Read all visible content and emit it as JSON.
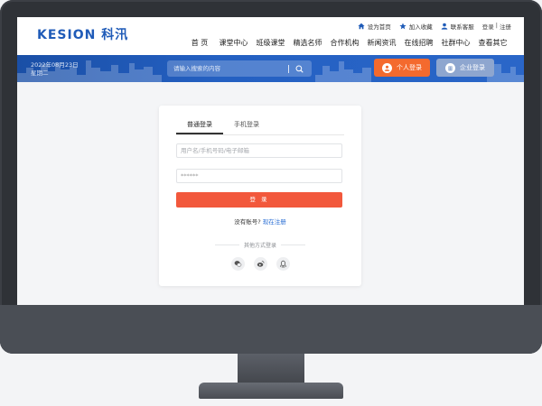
{
  "header": {
    "logo": "KESION 科汛",
    "top_links": [
      {
        "icon": "home-icon",
        "label": "设为首页"
      },
      {
        "icon": "star-icon",
        "label": "加入收藏"
      },
      {
        "icon": "user-icon",
        "label": "联系客服"
      }
    ],
    "login_label": "登录",
    "auth_separator": "|",
    "register_label": "注册",
    "nav": [
      "首 页",
      "课堂中心",
      "班级课堂",
      "精选名师",
      "合作机构",
      "新闻资讯",
      "在线招聘",
      "社群中心",
      "查看其它"
    ]
  },
  "banner": {
    "date": "2022年08月23日",
    "weekday": "星期二",
    "search_placeholder": "请输入搜索的内容",
    "personal_login": "个人登录",
    "company_login": "企业登录"
  },
  "login": {
    "tabs": [
      "普通登录",
      "手机登录"
    ],
    "active_tab": 0,
    "username_placeholder": "用户名/手机号码/电子邮箱",
    "password_value": "******",
    "login_button": "登 录",
    "no_account": "没有账号?",
    "register_now": "现在注册",
    "other_methods": "其他方式登录",
    "social": [
      "wechat-icon",
      "weibo-icon",
      "qq-icon"
    ]
  },
  "colors": {
    "brand": "#1f5bb8",
    "banner": "#2460c2",
    "personal_button": "#f46a2e",
    "company_button": "#8ea6cf",
    "login_button": "#f2583c",
    "link": "#2b6fd4"
  }
}
